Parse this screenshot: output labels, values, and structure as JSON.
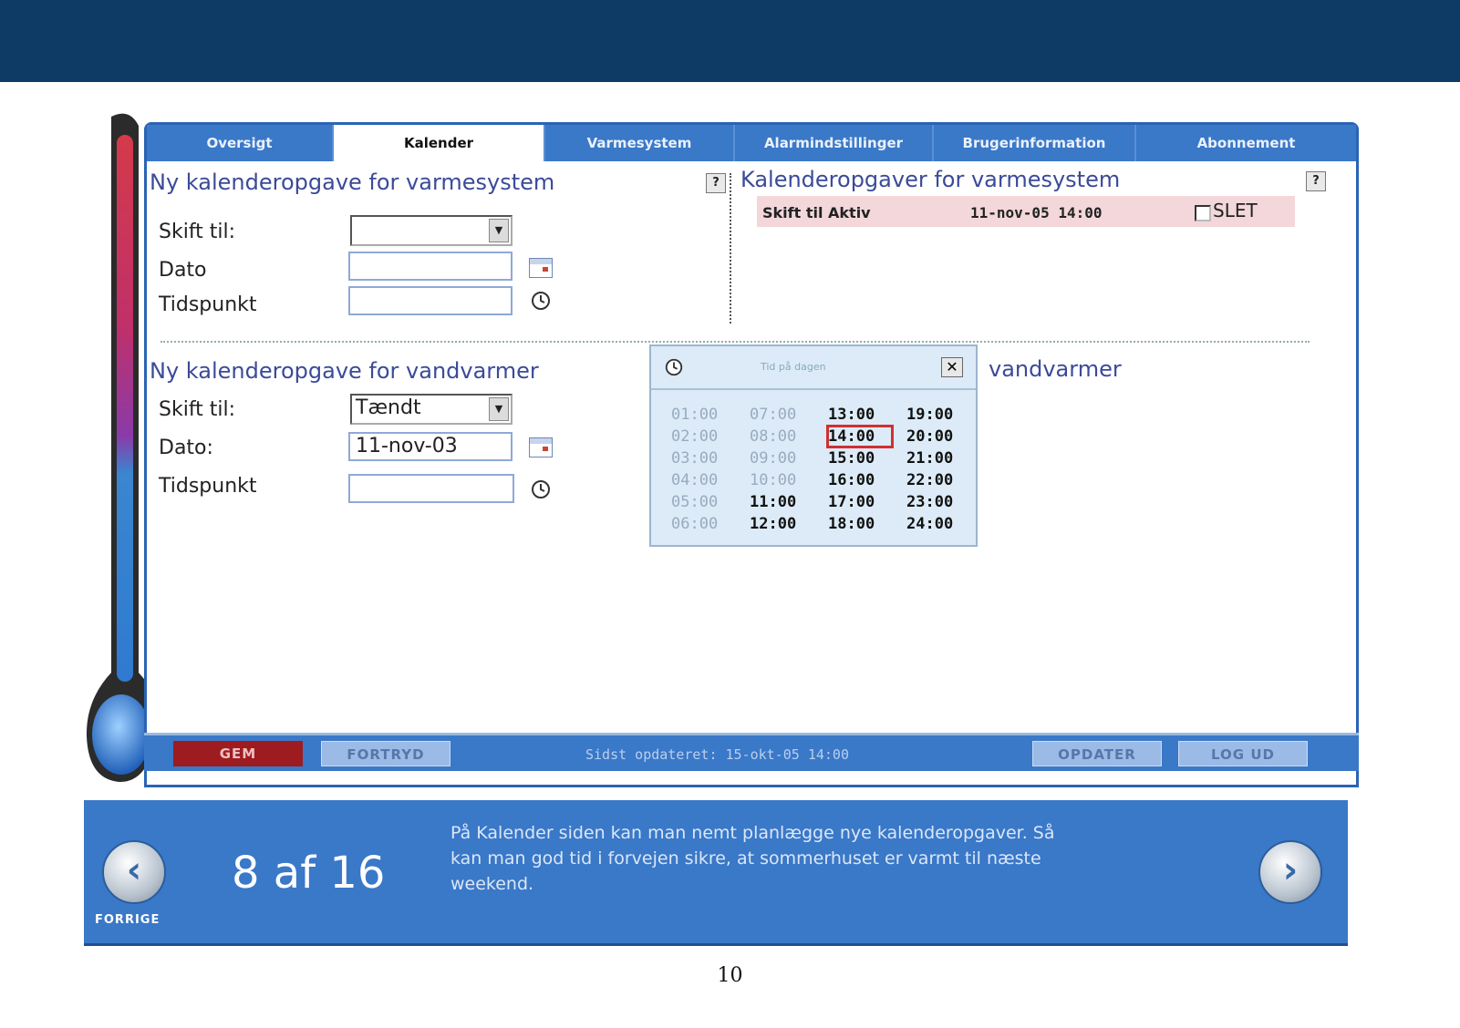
{
  "tabs": [
    {
      "label": "Oversigt"
    },
    {
      "label": "Kalender"
    },
    {
      "label": "Varmesystem"
    },
    {
      "label": "Alarmindstillinger"
    },
    {
      "label": "Brugerinformation"
    },
    {
      "label": "Abonnement"
    }
  ],
  "heating_new": {
    "title": "Ny kalenderopgave for varmesystem",
    "switch_label": "Skift til:",
    "switch_value": "",
    "date_label": "Dato",
    "date_value": "",
    "time_label": "Tidspunkt",
    "time_value": ""
  },
  "heating_tasks": {
    "title": "Kalenderopgaver for varmesystem",
    "rows": [
      {
        "task": "Skift til Aktiv",
        "when": "11-nov-05 14:00",
        "delete_label": "SLET"
      }
    ]
  },
  "water_new": {
    "title": "Ny kalenderopgave for vandvarmer",
    "switch_label": "Skift til:",
    "switch_value": "Tændt",
    "date_label": "Dato:",
    "date_value": "11-nov-03",
    "time_label": "Tidspunkt",
    "time_value": ""
  },
  "water_tasks": {
    "title_visible": "vandvarmer"
  },
  "help_icon": "?",
  "time_popup": {
    "title": "Tid på dagen",
    "close": "✕",
    "columns": [
      [
        {
          "t": "01:00",
          "state": "past"
        },
        {
          "t": "02:00",
          "state": "past"
        },
        {
          "t": "03:00",
          "state": "past"
        },
        {
          "t": "04:00",
          "state": "past"
        },
        {
          "t": "05:00",
          "state": "past"
        },
        {
          "t": "06:00",
          "state": "past"
        }
      ],
      [
        {
          "t": "07:00",
          "state": "past"
        },
        {
          "t": "08:00",
          "state": "past"
        },
        {
          "t": "09:00",
          "state": "past"
        },
        {
          "t": "10:00",
          "state": "past"
        },
        {
          "t": "11:00",
          "state": "avail"
        },
        {
          "t": "12:00",
          "state": "avail"
        }
      ],
      [
        {
          "t": "13:00",
          "state": "avail"
        },
        {
          "t": "14:00",
          "state": "selected"
        },
        {
          "t": "15:00",
          "state": "avail"
        },
        {
          "t": "16:00",
          "state": "avail"
        },
        {
          "t": "17:00",
          "state": "avail"
        },
        {
          "t": "18:00",
          "state": "avail"
        }
      ],
      [
        {
          "t": "19:00",
          "state": "avail"
        },
        {
          "t": "20:00",
          "state": "avail"
        },
        {
          "t": "21:00",
          "state": "avail"
        },
        {
          "t": "22:00",
          "state": "avail"
        },
        {
          "t": "23:00",
          "state": "avail"
        },
        {
          "t": "24:00",
          "state": "avail"
        }
      ]
    ]
  },
  "bottom_bar": {
    "save": "GEM",
    "undo": "FORTRYD",
    "status": "Sidst opdateret: 15-okt-05 14:00",
    "refresh": "OPDATER",
    "logout": "LOG UD"
  },
  "nav": {
    "prev_label": "FORRIGE",
    "prev_icon": "chevron-left-icon",
    "next_icon": "chevron-right-icon",
    "pager": "8 af 16",
    "description": "På Kalender siden kan man nemt planlægge nye kalenderopgaver. Så kan man god tid i forvejen sikre, at sommerhuset er varmt til næste weekend."
  },
  "page_number": "10",
  "colors": {
    "header": "#0d3b66",
    "tab_bg": "#3a78c8",
    "save_button": "#9e1b20",
    "task_row": "#f3d7da"
  }
}
